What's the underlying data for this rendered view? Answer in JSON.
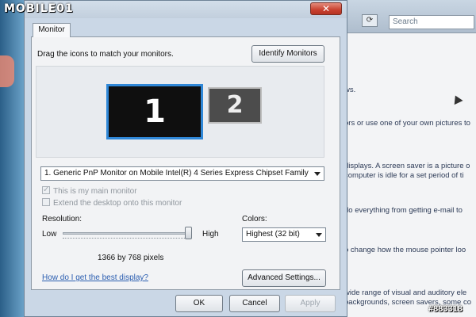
{
  "logo": "MOBILE01",
  "watermark": "#883318",
  "title_bar": {
    "close_label": "✕"
  },
  "dialog": {
    "tab_label": "Monitor",
    "drag_instruction": "Drag the icons to match your monitors.",
    "identify_button": "Identify Monitors",
    "monitor1_label": "1",
    "monitor2_label": "2",
    "display_select": "1. Generic PnP Monitor on Mobile Intel(R) 4 Series Express Chipset Family",
    "main_monitor_check": "This is my main monitor",
    "main_monitor_checked": true,
    "extend_desktop_check": "Extend the desktop onto this monitor",
    "extend_desktop_checked": false,
    "resolution_label": "Resolution:",
    "resolution_low": "Low",
    "resolution_high": "High",
    "resolution_value": "1366 by 768 pixels",
    "resolution_level": 1.0,
    "colors_label": "Colors:",
    "colors_select": "Highest (32 bit)",
    "help_link": "How do I get the best display?",
    "advanced_button": "Advanced Settings...",
    "ok_button": "OK",
    "cancel_button": "Cancel",
    "apply_button": "Apply"
  },
  "background_window": {
    "search_placeholder": "Search",
    "text_lines": [
      "ws.",
      "ors or use one of your own pictures to",
      "displays. A screen saver is a picture o",
      "computer is idle for a set period of ti",
      "do everything from getting e-mail to",
      "o change how the mouse pointer loo",
      "wide range of visual and auditory ele",
      "backgrounds, screen savers, some co"
    ]
  }
}
